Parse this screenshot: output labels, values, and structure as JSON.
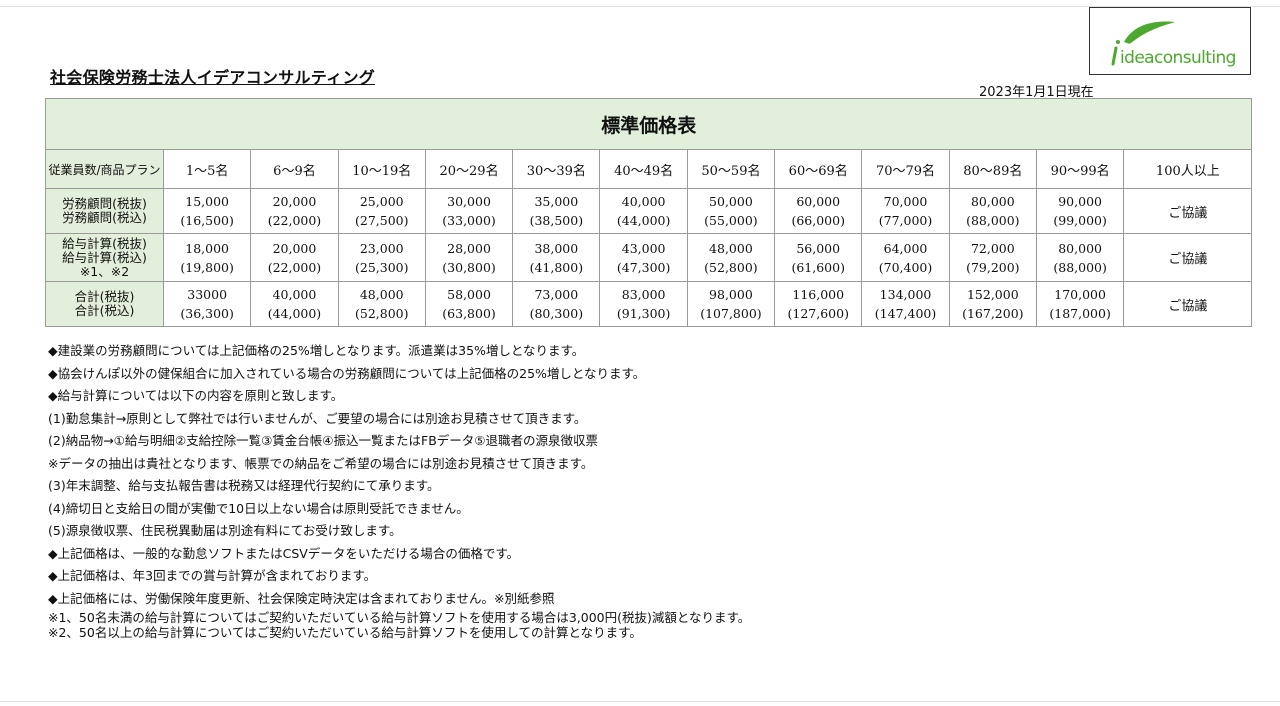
{
  "company": "社会保険労務士法人イデアコンサルティング",
  "date": "2023年1月1日現在",
  "logo_text": "ideaconsulting",
  "table": {
    "title": "標準価格表",
    "corner": "従業員数/商品プラン",
    "columns": [
      "1～5名",
      "6～9名",
      "10～19名",
      "20～29名",
      "30～39名",
      "40～49名",
      "50～59名",
      "60～69名",
      "70～79名",
      "80～89名",
      "90～99名",
      "100人以上"
    ],
    "rows": [
      {
        "label": [
          "労務顧問(税抜)",
          "労務顧問(税込)"
        ],
        "top": [
          "15,000",
          "20,000",
          "25,000",
          "30,000",
          "35,000",
          "40,000",
          "50,000",
          "60,000",
          "70,000",
          "80,000",
          "90,000"
        ],
        "bottom": [
          "(16,500)",
          "(22,000)",
          "(27,500)",
          "(33,000)",
          "(38,500)",
          "(44,000)",
          "(55,000)",
          "(66,000)",
          "(77,000)",
          "(88,000)",
          "(99,000)"
        ],
        "last": "ご協議"
      },
      {
        "label": [
          "給与計算(税抜)",
          "給与計算(税込)",
          "※1、※2"
        ],
        "top": [
          "18,000",
          "20,000",
          "23,000",
          "28,000",
          "38,000",
          "43,000",
          "48,000",
          "56,000",
          "64,000",
          "72,000",
          "80,000"
        ],
        "bottom": [
          "(19,800)",
          "(22,000)",
          "(25,300)",
          "(30,800)",
          "(41,800)",
          "(47,300)",
          "(52,800)",
          "(61,600)",
          "(70,400)",
          "(79,200)",
          "(88,000)"
        ],
        "last": "ご協議"
      },
      {
        "label": [
          "合計(税抜)",
          "合計(税込)"
        ],
        "top": [
          "33000",
          "40,000",
          "48,000",
          "58,000",
          "73,000",
          "83,000",
          "98,000",
          "116,000",
          "134,000",
          "152,000",
          "170,000"
        ],
        "bottom": [
          "(36,300)",
          "(44,000)",
          "(52,800)",
          "(63,800)",
          "(80,300)",
          "(91,300)",
          "(107,800)",
          "(127,600)",
          "(147,400)",
          "(167,200)",
          "(187,000)"
        ],
        "last": "ご協議"
      }
    ]
  },
  "notes": [
    "◆建設業の労務顧問については上記価格の25%増しとなります。派遣業は35%増しとなります。",
    "◆協会けんぽ以外の健保組合に加入されている場合の労務顧問については上記価格の25%増しとなります。",
    "◆給与計算については以下の内容を原則と致します。",
    "(1)勤怠集計→原則として弊社では行いませんが、ご要望の場合には別途お見積させて頂きます。",
    "(2)納品物→①給与明細②支給控除一覧③賃金台帳④振込一覧またはFBデータ⑤退職者の源泉徴収票",
    "※データの抽出は貴社となります、帳票での納品をご希望の場合には別途お見積させて頂きます。",
    "(3)年末調整、給与支払報告書は税務又は経理代行契約にて承ります。",
    "(4)締切日と支給日の間が実働で10日以上ない場合は原則受託できません。",
    "(5)源泉徴収票、住民税異動届は別途有料にてお受け致します。",
    "◆上記価格は、一般的な勤怠ソフトまたはCSVデータをいただける場合の価格です。",
    "◆上記価格は、年3回までの賞与計算が含まれております。",
    "◆上記価格には、労働保険年度更新、社会保険定時決定は含まれておりません。※別紙参照"
  ],
  "footnotes": [
    "※1、50名未満の給与計算についてはご契約いただいている給与計算ソフトを使用する場合は3,000円(税抜)減額となります。",
    "※2、50名以上の給与計算についてはご契約いただいている給与計算ソフトを使用しての計算となります。"
  ],
  "colors": {
    "header_green": "#e2efda",
    "logo_green": "#4ca82e"
  }
}
